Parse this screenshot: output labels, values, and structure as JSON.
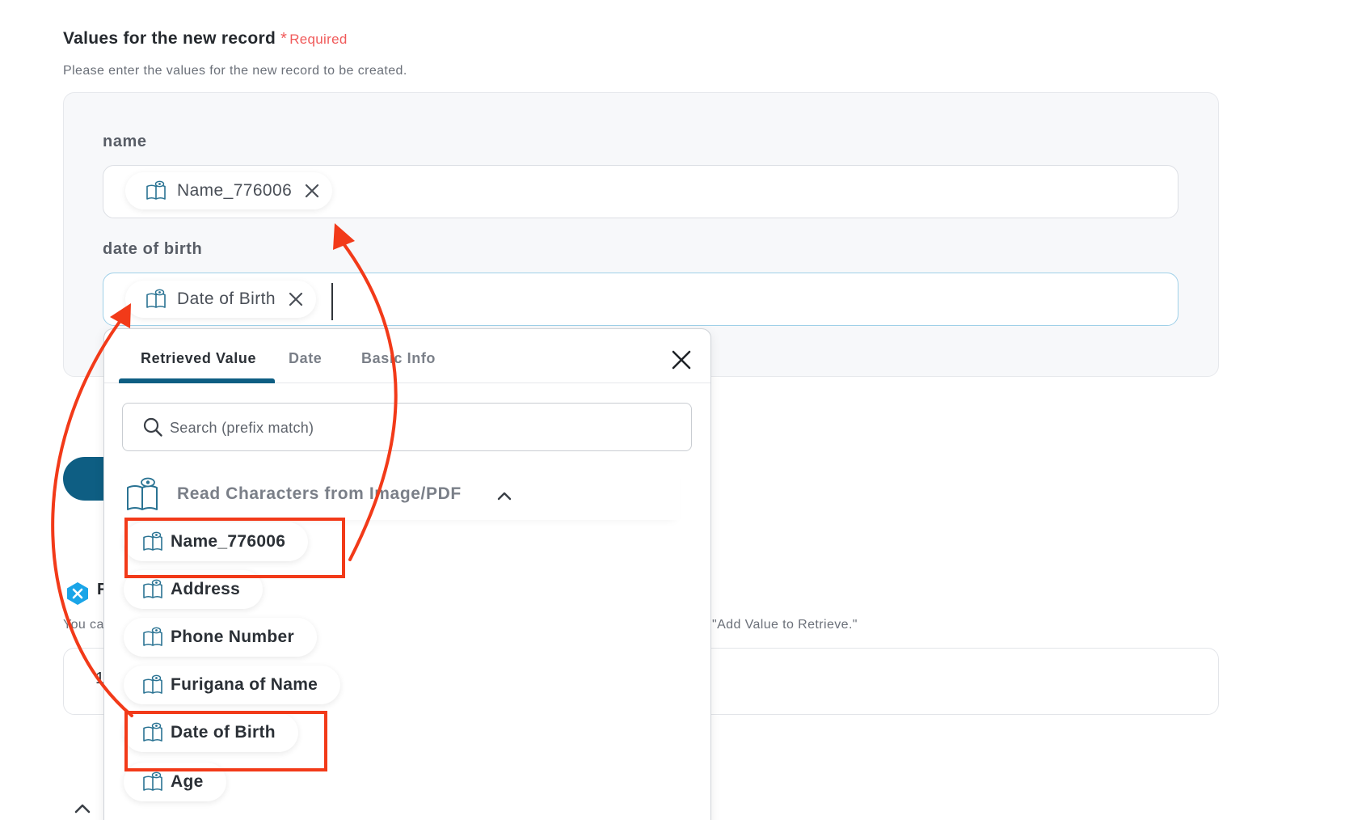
{
  "section": {
    "title": "Values for the new record",
    "required_mark": "*",
    "required_label": "Required",
    "description": "Please enter the values for the new record to be created."
  },
  "fields": [
    {
      "label": "name",
      "chip": "Name_776006"
    },
    {
      "label": "date of birth",
      "chip": "Date of Birth"
    }
  ],
  "background": {
    "partial_letter": "F",
    "partial_text_left": "You ca",
    "partial_text_right": "\"Add Value to Retrieve.\"",
    "row_digit": "1"
  },
  "popup": {
    "tabs": [
      {
        "label": "Retrieved Value",
        "active": true
      },
      {
        "label": "Date",
        "active": false
      },
      {
        "label": "Basic Info",
        "active": false
      }
    ],
    "search_placeholder": "Search (prefix match)",
    "group_label": "Read Characters from Image/PDF",
    "items": [
      "Name_776006",
      "Address",
      "Phone Number",
      "Furigana of Name",
      "Date of Birth",
      "Age"
    ]
  },
  "icons": {
    "item_icon": "book-eye-icon",
    "remove_icon": "close-icon",
    "group_toggle": "chevron-up-icon",
    "search": "search-icon",
    "dialog_close": "close-icon",
    "badge": "x-badge-icon"
  },
  "colors": {
    "accent": "#0e5e83",
    "required": "#f05a5a",
    "annotation": "#f23a19",
    "icon_teal": "#2a7393",
    "badge_blue": "#1aa5e8"
  }
}
